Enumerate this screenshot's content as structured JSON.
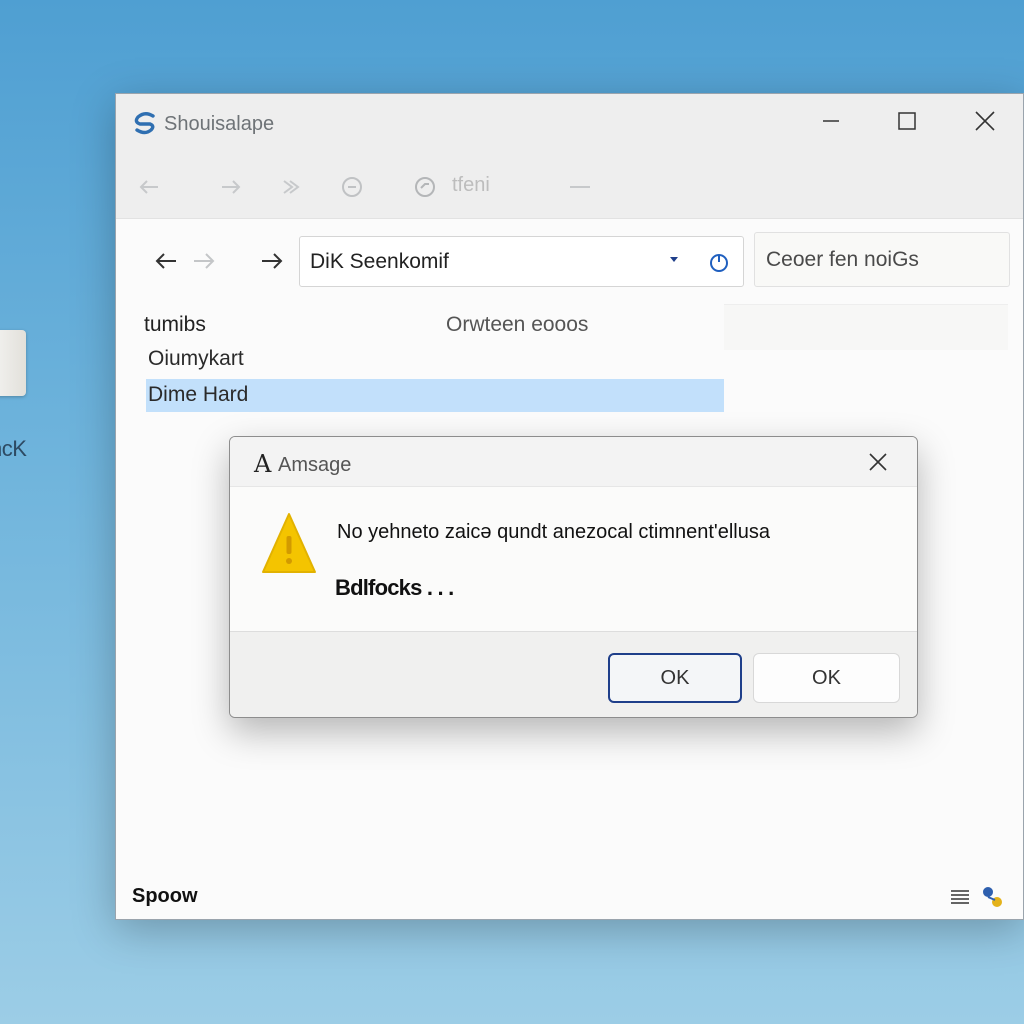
{
  "desktop": {
    "icon_label": "ncK"
  },
  "window": {
    "title": "Shouisalape",
    "ribbon_text": "tfeni",
    "address": "DiK Seenkomif",
    "search_placeholder": "Ceoer fen noiGs",
    "columns": {
      "name": "tumibs",
      "date": "Orwteen eooos"
    },
    "files": [
      {
        "name": "Oiumykart"
      },
      {
        "name": "Dime Hard"
      }
    ],
    "status": "Spoow"
  },
  "dialog": {
    "title": "Amsage",
    "title_glyph": "A",
    "message": "No yehneto zaicə qundt anezocal ctimnent'ellusa",
    "subtext": "Bdlfocks . . .",
    "ok_primary": "OK",
    "ok_secondary": "OK"
  },
  "icons": {
    "app": "app-logo-icon",
    "back": "back-arrow-icon",
    "forward": "forward-arrow-icon",
    "refresh": "refresh-icon",
    "warning": "warning-icon",
    "close": "close-icon"
  },
  "colors": {
    "accent": "#1f3f8a",
    "selection": "#c2e0fb",
    "warning": "#f4c400"
  }
}
